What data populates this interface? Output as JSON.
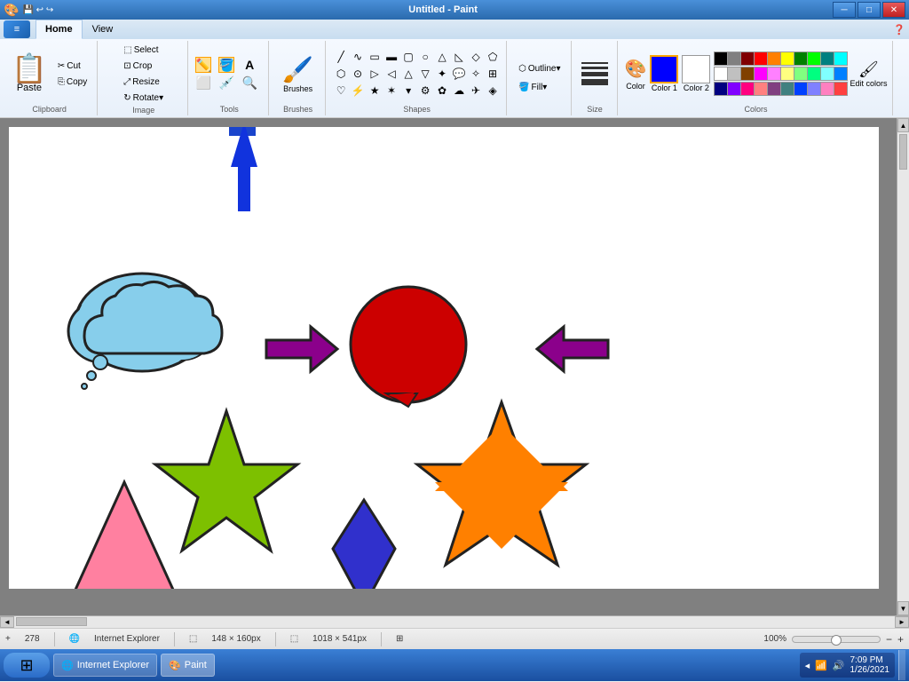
{
  "titlebar": {
    "title": "Untitled - Paint",
    "min": "─",
    "max": "□",
    "close": "✕"
  },
  "ribbon": {
    "tabs": [
      "Home",
      "View"
    ],
    "active_tab": "Home",
    "groups": {
      "clipboard": {
        "label": "Clipboard",
        "paste": "Paste",
        "cut": "Cut",
        "copy": "Copy"
      },
      "image": {
        "label": "Image",
        "crop": "Crop",
        "resize": "Resize",
        "rotate": "Rotate▾",
        "select": "Select"
      },
      "tools": {
        "pencil": "✏",
        "fill": "◈",
        "text": "A",
        "eraser": "◻",
        "picker": "⊕",
        "magnifier": "🔍"
      },
      "brushes": {
        "label": "Brushes"
      },
      "shapes": {
        "label": "Shapes"
      },
      "outline": "Outline▾",
      "fill": "Fill▾",
      "size": {
        "label": "Size"
      },
      "colors": {
        "label": "Colors",
        "color1_label": "Color 1",
        "color2_label": "Color 2",
        "edit_label": "Edit\ncolors"
      }
    }
  },
  "colors": {
    "selected": "#0000ff",
    "color2": "#ffffff",
    "palette": [
      "#000000",
      "#808080",
      "#800000",
      "#ff0000",
      "#ff8000",
      "#ffff00",
      "#008000",
      "#00ff00",
      "#008080",
      "#00ffff",
      "#ffffff",
      "#c0c0c0",
      "#804000",
      "#ff00ff",
      "#ff80ff",
      "#ffff80",
      "#80ff80",
      "#00ff80",
      "#80ffff",
      "#0080ff",
      "#000080",
      "#8000ff",
      "#ff0080",
      "#ff8080",
      "#804080",
      "#408080",
      "#0040ff",
      "#8080ff",
      "#ff80c0",
      "#ff4040"
    ]
  },
  "status": {
    "cursor": "278",
    "browser": "Internet Explorer",
    "dimensions1": "148 × 160px",
    "dimensions2": "1018 × 541px",
    "zoom": "100%"
  },
  "taskbar": {
    "items": [
      "Internet Explorer",
      "Paint"
    ],
    "time": "7:09 PM",
    "date": "1/26/2021"
  },
  "canvas": {
    "shapes": "visible"
  }
}
